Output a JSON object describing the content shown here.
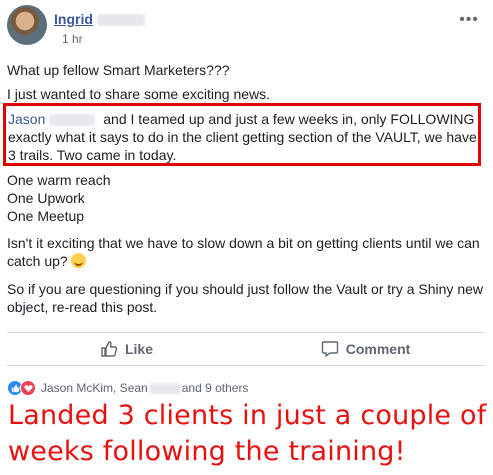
{
  "post": {
    "author_first_name": "Ingrid",
    "timestamp": "1 hr",
    "greeting": "What up fellow Smart Marketers???",
    "intro": "I just wanted to share some exciting news.",
    "highlight": {
      "mention": "Jason",
      "text": " and I teamed up and just a few weeks in, only FOLLOWING exactly what it says to do in the client getting section of the VAULT, we have 3 trails. Two came in today."
    },
    "sources": [
      "One warm reach",
      "One Upwork",
      "One Meetup"
    ],
    "paragraph_slow_down": "Isn't it exciting that we have to slow down a bit on getting clients until we can catch up?",
    "paragraph_question": "So if you are questioning if you should just follow the Vault or try a Shiny new object, re-read this post."
  },
  "actions": {
    "like_label": "Like",
    "comment_label": "Comment"
  },
  "reactions": {
    "names_start": "Jason McKim, Sean",
    "names_end": "and 9 others",
    "icons": [
      "like-icon",
      "love-icon"
    ]
  },
  "caption": {
    "text": "Landed 3 clients in just a couple of weeks following the training!"
  },
  "colors": {
    "link": "#385898",
    "highlight_border": "#e20000",
    "caption": "#e8110f",
    "like_blue": "#2d88ff",
    "love_red": "#f33e58"
  }
}
